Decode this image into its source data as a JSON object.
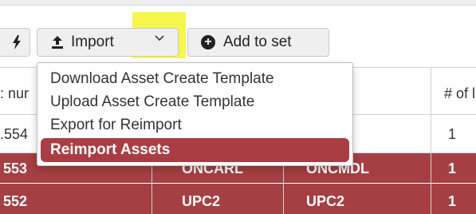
{
  "toolbar": {
    "import_label": "Import",
    "add_to_set_label": "Add to set"
  },
  "import_menu": {
    "items": [
      "Download Asset Create Template",
      "Upload Asset Create Template",
      "Export for Reimport",
      "Reimport Assets"
    ],
    "selected": "Reimport Assets"
  },
  "table": {
    "headers": [
      ": nur",
      "",
      "",
      "# of l"
    ],
    "rows": [
      [
        ".554",
        "",
        "",
        "1"
      ],
      [
        "553",
        "ONCARL",
        "ONCMDL",
        "1"
      ],
      [
        "552",
        "UPC2",
        "UPC2",
        "1"
      ]
    ]
  },
  "colors": {
    "selected_row": "#a53f43",
    "menu_highlight": "#a83e43",
    "marker_highlight": "#f5f53b"
  }
}
